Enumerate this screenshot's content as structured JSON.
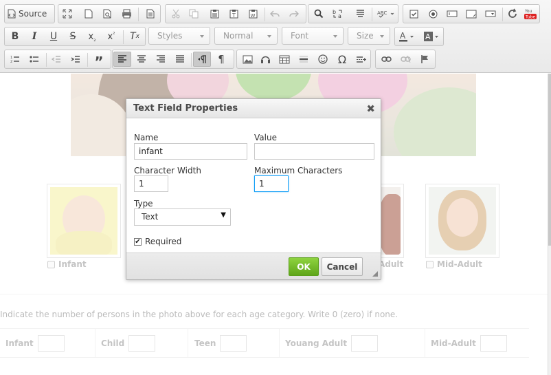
{
  "toolbar": {
    "source_label": "Source",
    "styles_label": "Styles",
    "format_label": "Normal",
    "font_label": "Font",
    "size_label": "Size"
  },
  "content": {
    "photo_captions": [
      "Infant",
      "Adult",
      "Mid-Adult"
    ],
    "instruction": "Indicate the number of persons in the photo above for each age category. Write 0 (zero) if none.",
    "count_fields": [
      "Infant",
      "Child",
      "Teen",
      "Youang Adult",
      "Mid-Adult"
    ]
  },
  "dialog": {
    "title": "Text Field Properties",
    "close": "✖",
    "name_label": "Name",
    "name_value": "infant",
    "value_label": "Value",
    "value_value": "",
    "char_width_label": "Character Width",
    "char_width_value": "1",
    "max_chars_label": "Maximum Characters",
    "max_chars_value": "1",
    "type_label": "Type",
    "type_value": "Text",
    "required_label": "Required",
    "required_checked": true,
    "ok_label": "OK",
    "cancel_label": "Cancel"
  },
  "colors": {
    "ok_button": "#6bb524",
    "focus_border": "#139ff7",
    "toolbar_bg": "#f0f0f0"
  }
}
